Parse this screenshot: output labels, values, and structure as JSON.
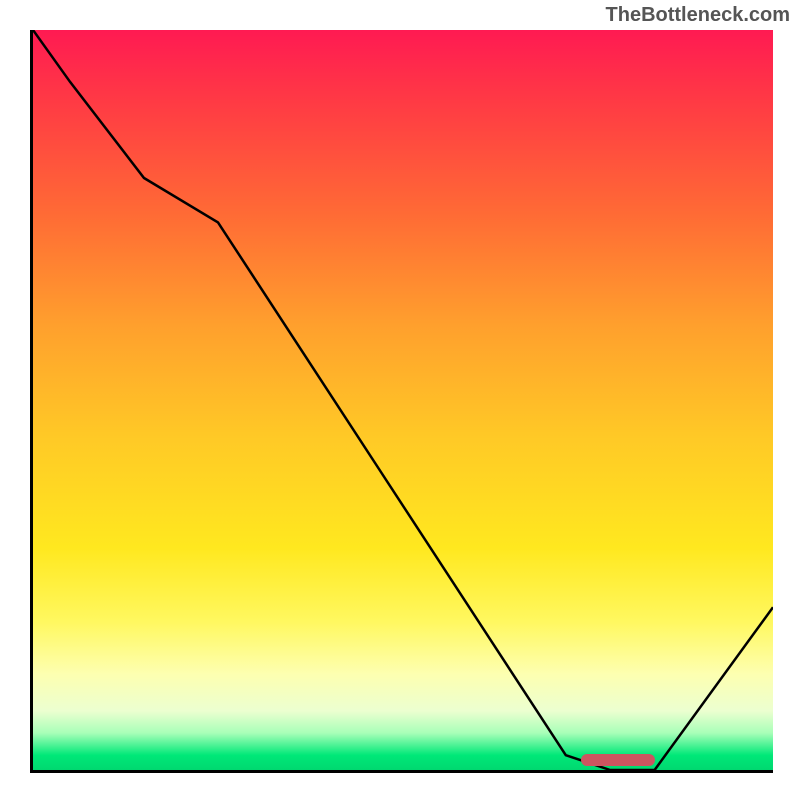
{
  "watermark": "TheBottleneck.com",
  "chart_data": {
    "type": "line",
    "x": [
      0,
      5,
      15,
      25,
      72,
      78,
      84,
      100
    ],
    "values": [
      100,
      93,
      80,
      74,
      2,
      0,
      0,
      22
    ],
    "title": "",
    "xlabel": "",
    "ylabel": "",
    "xlim": [
      0,
      100
    ],
    "ylim": [
      0,
      100
    ],
    "marker": {
      "x_start": 74,
      "x_end": 84,
      "y": 1
    },
    "gradient_stops": [
      {
        "pos": 0,
        "color": "#ff1a52"
      },
      {
        "pos": 25,
        "color": "#ff6b35"
      },
      {
        "pos": 55,
        "color": "#ffc926"
      },
      {
        "pos": 80,
        "color": "#fff860"
      },
      {
        "pos": 95,
        "color": "#a8ffb8"
      },
      {
        "pos": 100,
        "color": "#00d870"
      }
    ]
  }
}
